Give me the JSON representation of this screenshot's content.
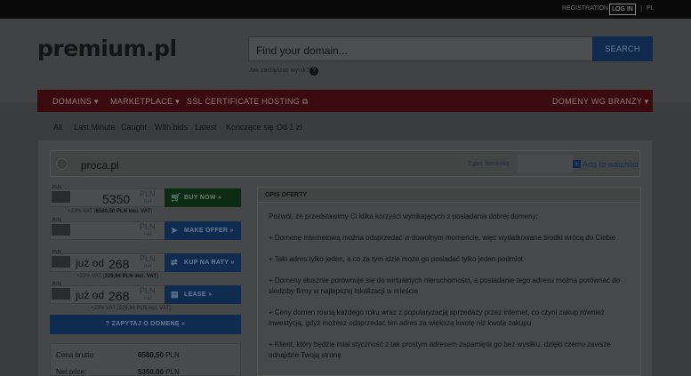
{
  "topbar": {
    "registration": "REGISTRATION",
    "login": "LOG IN",
    "separator": "|",
    "lang": "PL"
  },
  "header": {
    "logo": "premium.pl",
    "search_placeholder": "Find your domain...",
    "search_button": "SEARCH",
    "hint": "Jak zarządzać wynik?",
    "hint_icon": "?"
  },
  "nav": {
    "items": [
      "DOMAINS ▾",
      "MARKETPLACE ▾",
      "SSL CERTIFICATE",
      "HOSTING ⧉"
    ],
    "right": "DOMENY WG BRANŻY ▾"
  },
  "filters": [
    "All",
    "Last Minute",
    "Caught",
    "With bids",
    "Latest",
    "Kończące się",
    "Od 1 zł"
  ],
  "domain": {
    "icon": "◦",
    "name": "proca.pl",
    "report": "Zgłoś literówkę",
    "watch_icon": "+",
    "watchlist": "Add to watchlist"
  },
  "offers": [
    {
      "badge": "PLN",
      "prefix": "",
      "amount": "5350",
      "currency": "PLN",
      "net": "net",
      "action": "BUY NOW »",
      "action_icon": "🛒",
      "vat_prefix": "+23% VAT (",
      "vat_bold": "6580,50 PLN incl. VAT",
      "vat_suffix": ")"
    },
    {
      "badge": "PLN",
      "prefix": "",
      "amount": "",
      "currency": "PLN",
      "net": "net",
      "action": "MAKE OFFER »",
      "action_icon": "➤",
      "vat_prefix": "",
      "vat_bold": "",
      "vat_suffix": ""
    },
    {
      "badge": "PLN",
      "prefix": "już od",
      "amount": "268",
      "currency": "PLN",
      "net": "net",
      "action": "KUP NA RATY »",
      "action_icon": "⇄",
      "vat_prefix": "+23% VAT (",
      "vat_bold": "329,64 PLN incl. VAT",
      "vat_suffix": ")"
    },
    {
      "badge": "PLN",
      "prefix": "już od",
      "amount": "268",
      "currency": "PLN",
      "net": "net",
      "action": "LEASE »",
      "action_icon": "▤",
      "vat_prefix": "+23% VAT (329,64 PLN incl. VAT)",
      "vat_bold": "",
      "vat_suffix": ""
    }
  ],
  "ask": "? ZAPYTAJ O DOMENĘ »",
  "stats": [
    {
      "label": "Cena brutto:",
      "value": "6580,50",
      "unit": "PLN"
    },
    {
      "label": "Net price:",
      "value": "5350,00",
      "unit": "PLN"
    }
  ],
  "description": {
    "title": "OPIS OFERTY",
    "paragraphs": [
      "Pozwól, że przedstawimy Ci kilka korzyści wynikających z posiadania dobrej domeny:",
      "+ Domenę internetową można odsprzedać w dowolnym momencie, więc wydatkowane środki wrócą do Ciebie",
      "+ Taki adres tylko jeden, a co za tym idzie może go posiadać tylko jeden podmiot",
      "+ Domeny słusznie porównuje się do wirtualnych nieruchomości, a posiadanie tego adresu można porównać do siedziby firmy w najlepszej lokalizacji w mieście",
      "+ Ceny domen rosną każdego roku wraz z popularyzacją sprzedaży przez internet, co czyni zakup również inwestycją, gdyż możesz odsprzedać ten adres za większą kwotę niż kwota zakupu",
      "+ Klient, który będzie miał styczność z tak prostym adresem zapamięta go bez wysiłku, dzięki czemu zawsze odnajdzie Twoją stronę"
    ]
  }
}
